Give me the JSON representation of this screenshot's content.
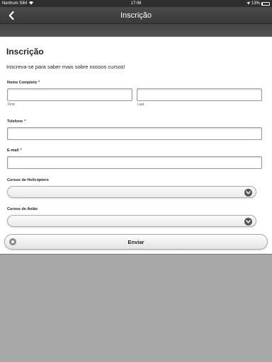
{
  "status_bar": {
    "carrier": "Nenhum SIM",
    "time": "17:06",
    "battery": "13%",
    "battery_level": 0.13
  },
  "nav": {
    "title": "Inscrição",
    "back_icon": "chevron-left-icon"
  },
  "form": {
    "title": "Inscrição",
    "intro": "Inscreva-se para saber mais sobre nossos cursos!",
    "name": {
      "label": "Nome Completo",
      "required": "*",
      "first_sublabel": "First",
      "last_sublabel": "Last",
      "first_value": "",
      "last_value": ""
    },
    "phone": {
      "label": "Telefone",
      "required": "*",
      "value": ""
    },
    "email": {
      "label": "E-mail",
      "required": "*",
      "value": ""
    },
    "helicopter": {
      "label": "Cursos de Helicóptero",
      "selected": ""
    },
    "airplane": {
      "label": "Cursos de Avião",
      "selected": ""
    },
    "submit": {
      "label": "Enviar",
      "icon": "circle-icon"
    }
  }
}
